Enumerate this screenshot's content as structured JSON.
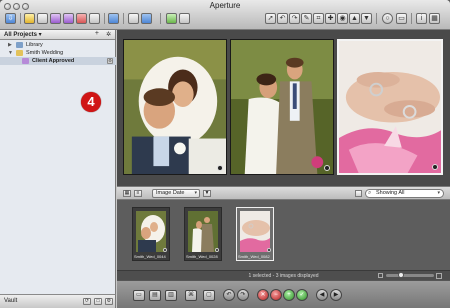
{
  "window": {
    "title": "Aperture"
  },
  "projects_panel": {
    "header_label": "All Projects ▾",
    "items": [
      {
        "label": "Library",
        "expanded": false,
        "icon": "library-icon"
      },
      {
        "label": "Smith Wedding",
        "expanded": true,
        "icon": "project-icon"
      },
      {
        "label": "Client Approved",
        "expanded": false,
        "icon": "smart-album-icon",
        "selected": true
      }
    ],
    "badge_number": "4"
  },
  "vault": {
    "label": "Vault"
  },
  "browser_toolbar": {
    "sort_select": "Image Date",
    "search_select": "Showing All"
  },
  "thumbnails": [
    {
      "caption": "Smith_Wed_0044",
      "selected": false
    },
    {
      "caption": "Smith_Wed_0028",
      "selected": false
    },
    {
      "caption": "Smith_Wed_0082",
      "selected": true
    }
  ],
  "status": {
    "text": "1 selected - 3 images displayed"
  },
  "colors": {
    "badge_red": "#d01515",
    "viewer_bg": "#4a4a4a",
    "selection_border": "#f3f3f3"
  }
}
